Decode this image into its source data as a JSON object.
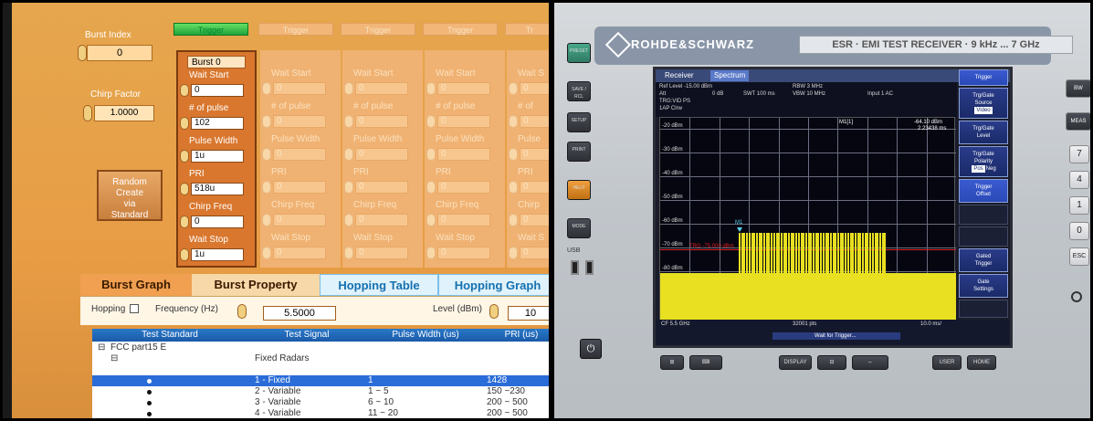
{
  "left_panel": {
    "burst_index": {
      "label": "Burst Index",
      "value": "0"
    },
    "chirp_factor": {
      "label": "Chirp Factor",
      "value": "1.0000"
    },
    "random_button": {
      "line1": "Random",
      "line2": "Create",
      "line3": "via",
      "line4": "Standard"
    },
    "trigger_tabs": [
      "Trigger",
      "Trigger",
      "Trigger",
      "Trigger",
      "Tr"
    ],
    "burst_columns": [
      {
        "header": "Burst 0",
        "wait_start_label": "Wait Start",
        "wait_start": "0",
        "num_pulse_label": "# of pulse",
        "num_pulse": "102",
        "pulse_width_label": "Pulse Width",
        "pulse_width": "1u",
        "pri_label": "PRI",
        "pri": "518u",
        "chirp_freq_label": "Chirp Freq",
        "chirp_freq": "0",
        "wait_stop_label": "Wait Stop",
        "wait_stop": "1u"
      },
      {
        "header": "",
        "wait_start_label": "Wait Start",
        "wait_start": "0",
        "num_pulse_label": "# of pulse",
        "num_pulse": "0",
        "pulse_width_label": "Pulse Width",
        "pulse_width": "0",
        "pri_label": "PRI",
        "pri": "0",
        "chirp_freq_label": "Chirp Freq",
        "chirp_freq": "0",
        "wait_stop_label": "Wait Stop",
        "wait_stop": "0"
      },
      {
        "header": "",
        "wait_start_label": "Wait Start",
        "wait_start": "0",
        "num_pulse_label": "# of pulse",
        "num_pulse": "0",
        "pulse_width_label": "Pulse Width",
        "pulse_width": "0",
        "pri_label": "PRI",
        "pri": "0",
        "chirp_freq_label": "Chirp Freq",
        "chirp_freq": "0",
        "wait_stop_label": "Wait Stop",
        "wait_stop": "0"
      },
      {
        "header": "",
        "wait_start_label": "Wait Start",
        "wait_start": "0",
        "num_pulse_label": "# of pulse",
        "num_pulse": "0",
        "pulse_width_label": "Pulse Width",
        "pulse_width": "0",
        "pri_label": "PRI",
        "pri": "0",
        "chirp_freq_label": "Chirp Freq",
        "chirp_freq": "0",
        "wait_stop_label": "Wait Stop",
        "wait_stop": "0"
      },
      {
        "header": "",
        "wait_start_label": "Wait S",
        "wait_start": "0",
        "num_pulse_label": "# of",
        "num_pulse": "0",
        "pulse_width_label": "Pulse",
        "pulse_width": "0",
        "pri_label": "PRI",
        "pri": "0",
        "chirp_freq_label": "Chirp",
        "chirp_freq": "0",
        "wait_stop_label": "Wait S",
        "wait_stop": "0"
      }
    ],
    "tabs": {
      "burst_graph": "Burst Graph",
      "burst_property": "Burst Property",
      "hopping_table": "Hopping Table",
      "hopping_graph": "Hopping Graph"
    },
    "hopping_bar": {
      "hopping_label": "Hopping",
      "frequency_label": "Frequency (Hz)",
      "frequency_value": "5.5000",
      "level_label": "Level (dBm)",
      "level_value": "10"
    },
    "test_table": {
      "headers": [
        "Test Standard",
        "Test Signal",
        "Pulse Width (us)",
        "PRI (us)"
      ],
      "standard": "FCC part15 E",
      "group": "Fixed Radars",
      "rows": [
        {
          "signal": "1 - Fixed",
          "pulse_width": "1",
          "pri": "1428",
          "selected": true
        },
        {
          "signal": "2 - Variable",
          "pulse_width": "1 ~ 5",
          "pri": "150 ~230",
          "selected": false
        },
        {
          "signal": "3 - Variable",
          "pulse_width": "6 ~ 10",
          "pri": "200 ~ 500",
          "selected": false
        },
        {
          "signal": "4 - Variable",
          "pulse_width": "11 ~ 20",
          "pri": "200 ~ 500",
          "selected": false
        }
      ]
    }
  },
  "right_panel": {
    "brand": "ROHDE&SCHWARZ",
    "model_title": "ESR · EMI TEST RECEIVER · 9 kHz ... 7 GHz",
    "screen": {
      "tabs": [
        "Receiver",
        "Spectrum"
      ],
      "ref_level": "Ref Level -15.00 dBm",
      "att": "Att",
      "att_value": "0 dB",
      "swt": "SWT 100 ms",
      "rbw": "RBW 3 MHz",
      "vbw": "VBW 10 MHz",
      "input": "Input 1 AC",
      "trg": "TRG:VID PS",
      "trace": "1AP Clrw",
      "marker_label": "M1[1]",
      "marker_value": "-64.10 dBm",
      "marker_time": "2.23438 ms",
      "marker_tag": "M1",
      "y_labels": [
        "-20 dBm",
        "-30 dBm",
        "-40 dBm",
        "-50 dBm",
        "-60 dBm",
        "-70 dBm",
        "-80 dBm"
      ],
      "trg_label": "TRG -75.000 dBm",
      "cf": "CF 5.5 GHz",
      "pts": "32001 pts",
      "span": "10.0 ms/",
      "status": "Wait for Trigger..."
    },
    "softkeys": {
      "trigger": "Trigger",
      "trg_gate_source_l1": "Trg/Gate",
      "trg_gate_source_l2": "Source",
      "video": "Video",
      "trg_gate_level_l1": "Trg/Gate",
      "trg_gate_level_l2": "Level",
      "trg_gate_polarity_l1": "Trg/Gate",
      "trg_gate_polarity_l2": "Polarity",
      "pos": "Pos",
      "neg": "Neg",
      "trigger_offset_l1": "Trigger",
      "trigger_offset_l2": "Offset",
      "gated_trigger_l1": "Gated",
      "gated_trigger_l2": "Trigger",
      "gate_settings_l1": "Gate",
      "gate_settings_l2": "Settings"
    },
    "side_buttons": [
      "PRESET",
      "SAVE / RCL",
      "SETUP",
      "PRINT",
      "HELP",
      "MODE"
    ],
    "usb_label": "USB",
    "bottom_buttons": [
      "DISPLAY",
      "USER",
      "HOME"
    ],
    "keypad": [
      "7",
      "4",
      "1",
      "0",
      "ESC",
      "MEAS"
    ]
  }
}
